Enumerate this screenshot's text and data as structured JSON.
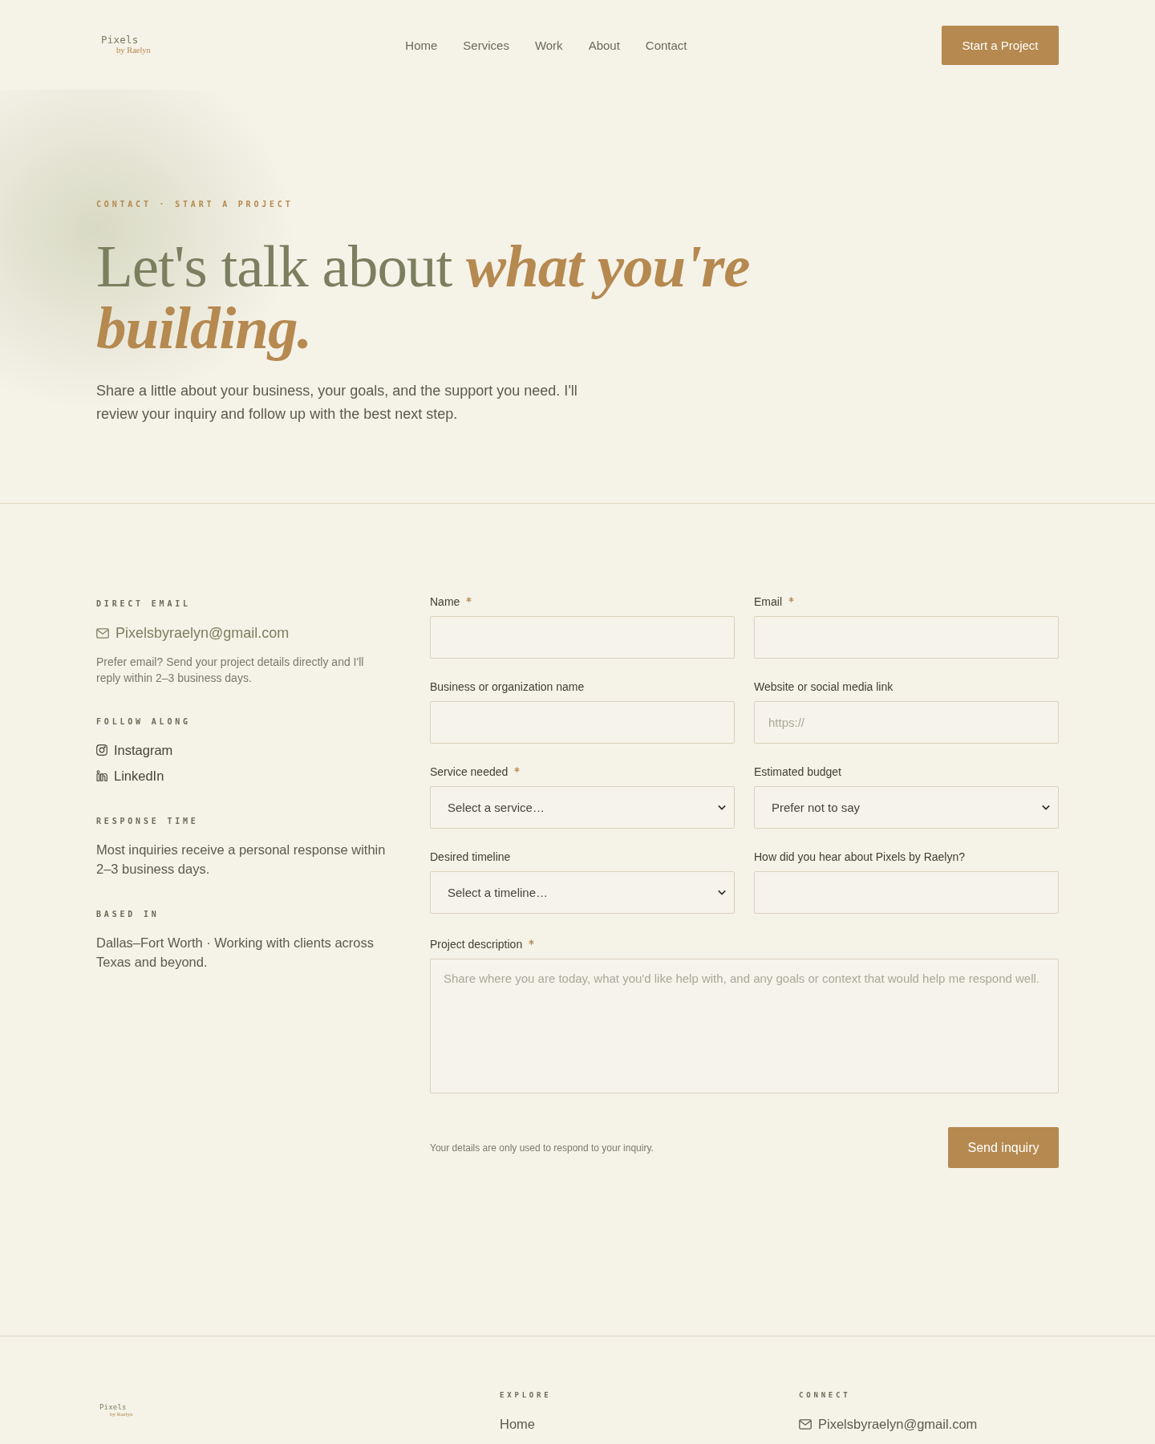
{
  "header": {
    "logo": {
      "name": "Pixels",
      "tagline": "by Raelyn"
    },
    "nav": [
      "Home",
      "Services",
      "Work",
      "About",
      "Contact"
    ],
    "cta": "Start a Project"
  },
  "hero": {
    "eyebrow": "CONTACT · START A PROJECT",
    "heading": "Let's talk about *what you're building.*",
    "intro": "Share a little about your business, your goals, and the support you need. I'll review your inquiry and follow up with the best next step."
  },
  "contact_info": [
    {
      "kind": "email",
      "heading": "DIRECT EMAIL",
      "email": "Pixelsbyraelyn@gmail.com",
      "note": "Prefer email? Send your project details directly and I'll reply within 2–3 business days."
    },
    {
      "kind": "links",
      "heading": "FOLLOW ALONG",
      "links": [
        {
          "kind": "instagram",
          "label": "Instagram"
        },
        {
          "kind": "linkedin",
          "label": "LinkedIn"
        }
      ]
    },
    {
      "kind": "text",
      "heading": "RESPONSE TIME",
      "text": "Most inquiries receive a personal response within 2–3 business days."
    },
    {
      "kind": "text",
      "heading": "BASED IN",
      "text": "Dallas–Fort Worth · Working with clients across Texas and beyond."
    }
  ],
  "form": {
    "fields": [
      {
        "kind": "text",
        "label": "Name",
        "required": true
      },
      {
        "kind": "text",
        "label": "Email",
        "required": true
      },
      {
        "kind": "text",
        "label": "Business or organization name",
        "required": false
      },
      {
        "kind": "text",
        "label": "Website or social media link",
        "required": false,
        "placeholder": "https://"
      },
      {
        "kind": "select",
        "label": "Service needed",
        "required": true,
        "value": "Select a service…"
      },
      {
        "kind": "select",
        "label": "Estimated budget",
        "required": false,
        "value": "Prefer not to say"
      },
      {
        "kind": "select",
        "label": "Desired timeline",
        "required": false,
        "value": "Select a timeline…"
      },
      {
        "kind": "text",
        "label": "How did you hear about Pixels by Raelyn?",
        "required": false
      },
      {
        "kind": "textarea",
        "label": "Project description",
        "required": true,
        "placeholder": "Share where you are today, what you'd like help with, and any goals or context that would help me respond well."
      }
    ],
    "privacy_note": "Your details are only used to respond to your inquiry.",
    "submit": "Send inquiry"
  },
  "footer": {
    "logo": {
      "name": "Pixels",
      "tagline": "by Raelyn"
    },
    "columns": [
      {
        "heading": "EXPLORE",
        "links": [
          {
            "kind": "plain",
            "label": "Home"
          }
        ]
      },
      {
        "heading": "CONNECT",
        "links": [
          {
            "kind": "email",
            "label": "Pixelsbyraelyn@gmail.com"
          }
        ]
      }
    ]
  }
}
